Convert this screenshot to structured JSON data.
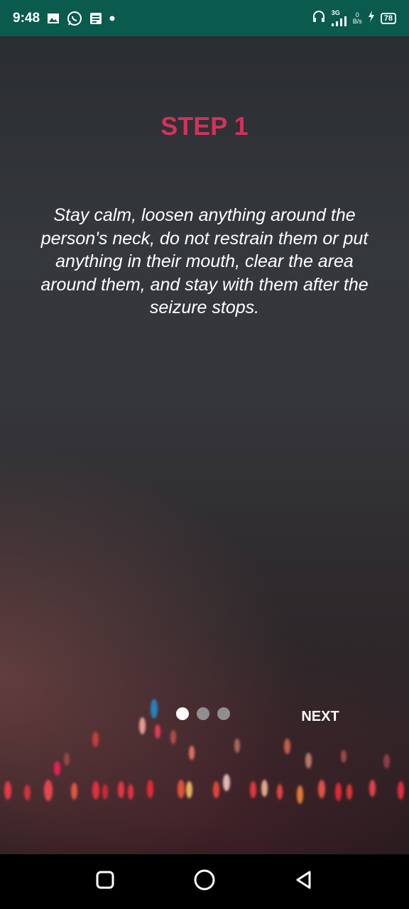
{
  "status_bar": {
    "time": "9:48",
    "network_type": "3G",
    "net_speed_value": "0",
    "net_speed_unit": "B/s",
    "battery_level": "78",
    "icons": [
      "image-icon",
      "whatsapp-icon",
      "notes-icon",
      "dot-icon",
      "headphones-icon",
      "signal-icon",
      "charging-icon",
      "battery-icon"
    ]
  },
  "onboarding": {
    "title": "STEP 1",
    "body": "Stay calm, loosen anything around the person's neck, do not restrain them or put anything in their mouth, clear the area around them, and stay with them after the seizure stops.",
    "page_indicator": {
      "count": 3,
      "active": 1
    },
    "next_label": "NEXT"
  },
  "colors": {
    "status_bar": "#0a5a4e",
    "title": "#d3315b",
    "text": "#ffffff",
    "dot_active": "#ffffff",
    "dot_inactive": "#8f8f8f"
  },
  "navigation": {
    "icons": [
      "recents-icon",
      "home-icon",
      "back-icon"
    ]
  }
}
